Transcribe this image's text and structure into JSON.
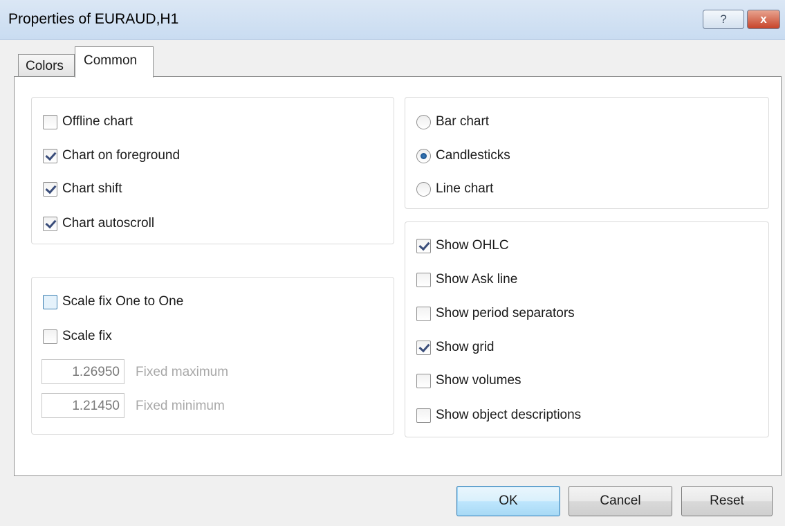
{
  "window": {
    "title": "Properties of EURAUD,H1",
    "help_label": "?",
    "close_label": "x"
  },
  "tabs": [
    {
      "label": "Colors",
      "active": false
    },
    {
      "label": "Common",
      "active": true
    }
  ],
  "chart_options": [
    {
      "label": "Offline chart",
      "checked": false
    },
    {
      "label": "Chart on foreground",
      "checked": true
    },
    {
      "label": "Chart shift",
      "checked": true
    },
    {
      "label": "Chart autoscroll",
      "checked": true
    }
  ],
  "scale": {
    "one_to_one_label": "Scale fix One to One",
    "one_to_one_checked": false,
    "scale_fix_label": "Scale fix",
    "scale_fix_checked": false,
    "fixed_max_value": "1.26950",
    "fixed_max_label": "Fixed maximum",
    "fixed_min_value": "1.21450",
    "fixed_min_label": "Fixed minimum"
  },
  "chart_type": {
    "options": [
      "Bar chart",
      "Candlesticks",
      "Line chart"
    ],
    "selected": "Candlesticks"
  },
  "show_options": [
    {
      "label": "Show OHLC",
      "checked": true
    },
    {
      "label": "Show Ask line",
      "checked": false
    },
    {
      "label": "Show period separators",
      "checked": false
    },
    {
      "label": "Show grid",
      "checked": true
    },
    {
      "label": "Show volumes",
      "checked": false
    },
    {
      "label": "Show object descriptions",
      "checked": false
    }
  ],
  "buttons": {
    "ok": "OK",
    "cancel": "Cancel",
    "reset": "Reset"
  }
}
